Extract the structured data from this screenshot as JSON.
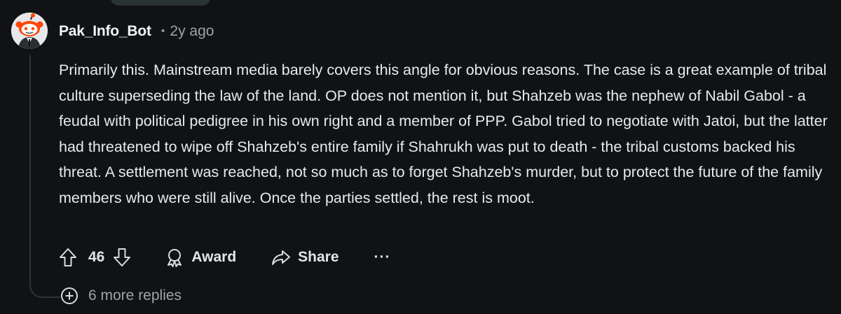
{
  "comment": {
    "author": "Pak_Info_Bot",
    "separator": "•",
    "age": "2y ago",
    "body": "Primarily this. Mainstream media barely covers this angle for obvious reasons. The case is a great example of tribal culture superseding the law of the land. OP does not mention it, but Shahzeb was the nephew of Nabil Gabol - a feudal with political pedigree in his own right and a member of PPP. Gabol tried to negotiate with Jatoi, but the latter had threatened to wipe off Shahzeb's entire family if Shahrukh was put to death - the tribal customs backed his threat. A settlement was reached, not so much as to forget Shahzeb's murder, but to protect the future of the family members who were still alive. Once the parties settled, the rest is moot.",
    "score": "46"
  },
  "actions": {
    "award_label": "Award",
    "share_label": "Share",
    "more_label": "···"
  },
  "replies": {
    "more_label": "6 more replies"
  },
  "icons": {
    "avatar": "snoo-avatar-icon",
    "upvote": "arrow-up-icon",
    "downvote": "arrow-down-icon",
    "award": "award-icon",
    "share": "share-icon",
    "more": "ellipsis-icon",
    "expand": "plus-circle-icon"
  },
  "colors": {
    "background": "#101214",
    "text": "#e8eaed",
    "muted": "#9aa3aa",
    "snoo_orange": "#ff4500"
  }
}
